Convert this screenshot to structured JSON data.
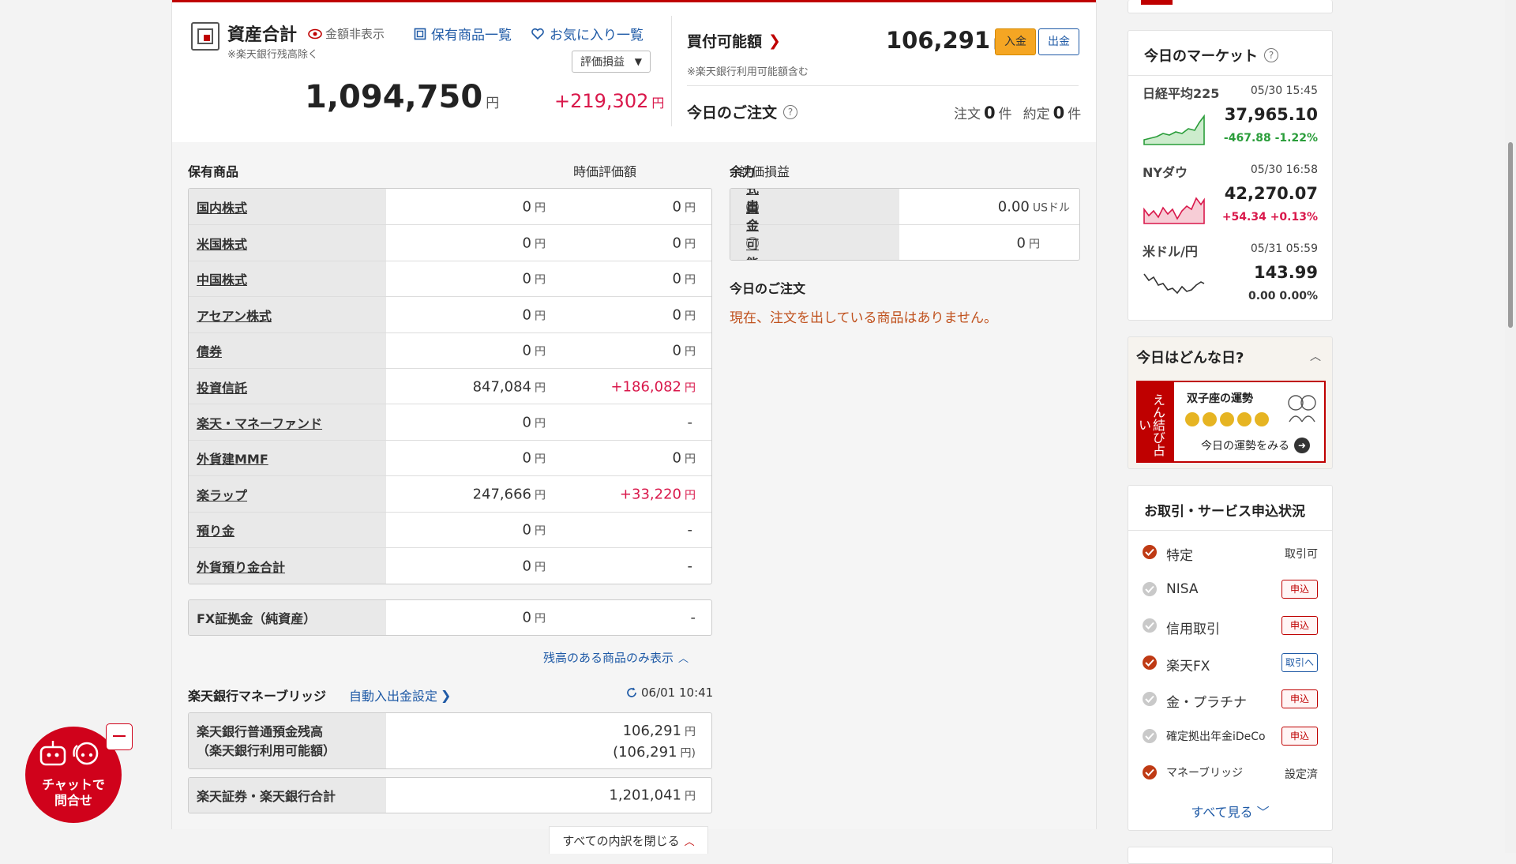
{
  "summary": {
    "title": "資産合計",
    "hide_amount": "金額非表示",
    "note": "※楽天銀行残高除く",
    "holdings_link": "保有商品一覧",
    "favorites_link": "お気に入り一覧",
    "select_label": "評価損益",
    "total_value": "1,094,750",
    "total_gain": "+219,302",
    "yen": "円"
  },
  "buying": {
    "label": "買付可能額",
    "value": "106,291",
    "yen": "円",
    "deposit_button": "入金",
    "withdraw_button": "出金",
    "note": "※楽天銀行利用可能額含む"
  },
  "today_orders": {
    "label": "今日のご注文",
    "orders_label": "注文",
    "orders_count": "0",
    "fills_label": "約定",
    "fills_count": "0",
    "unit": "件"
  },
  "holdings": {
    "header": "保有商品",
    "col_value": "時価評価額",
    "col_gain": "評価損益",
    "rows": [
      {
        "name": "国内株式",
        "value": "0",
        "gain": "0",
        "gain_yen": "円"
      },
      {
        "name": "米国株式",
        "value": "0",
        "gain": "0",
        "gain_yen": "円"
      },
      {
        "name": "中国株式",
        "value": "0",
        "gain": "0",
        "gain_yen": "円"
      },
      {
        "name": "アセアン株式",
        "value": "0",
        "gain": "0",
        "gain_yen": "円"
      },
      {
        "name": "債券",
        "value": "0",
        "gain": "0",
        "gain_yen": "円"
      },
      {
        "name": "投資信託",
        "value": "847,084",
        "gain": "+186,082",
        "gain_yen": "円"
      },
      {
        "name": "楽天・マネーファンド",
        "value": "0",
        "gain": "-",
        "gain_yen": ""
      },
      {
        "name": "外貨建MMF",
        "value": "0",
        "gain": "0",
        "gain_yen": "円"
      },
      {
        "name": "楽ラップ",
        "value": "247,666",
        "gain": "+33,220",
        "gain_yen": "円"
      },
      {
        "name": "預り金",
        "value": "0",
        "gain": "-",
        "gain_yen": ""
      },
      {
        "name": "外貨預り金合計",
        "value": "0",
        "gain": "-",
        "gain_yen": ""
      }
    ],
    "fx": {
      "name": "FX証拠金（純資産）",
      "value": "0",
      "gain": "-"
    },
    "show_toggle": "残高のある商品のみ表示",
    "yen": "円"
  },
  "yoryoku": {
    "header": "余力",
    "us_label": "米国株式買付可能額",
    "us_value": "0.00",
    "us_unit": "USドル",
    "withdraw_label": "出金可能額",
    "withdraw_value": "0",
    "yen": "円",
    "orders_title": "今日のご注文",
    "orders_empty": "現在、注文を出している商品はありません。"
  },
  "bridge": {
    "title": "楽天銀行マネーブリッジ",
    "auto_link": "自動入出金設定",
    "timestamp": "06/01 10:41",
    "balance_label_1": "楽天銀行普通預金残高",
    "balance_label_2": "（楽天銀行利用可能額）",
    "balance_value": "106,291",
    "balance_avail": "(106,291",
    "balance_avail_end": "円)",
    "total_label": "楽天証券・楽天銀行合計",
    "total_value": "1,201,041",
    "yen": "円",
    "close_all": "すべての内訳を閉じる"
  },
  "market": {
    "title": "今日のマーケット",
    "items": [
      {
        "name": "日経平均225",
        "time": "05/30 15:45",
        "value": "37,965.10",
        "change": "-467.88 -1.22%",
        "color": "#2a9d3a"
      },
      {
        "name": "NYダウ",
        "time": "05/30 16:58",
        "value": "42,270.07",
        "change": "+54.34 +0.13%",
        "color": "#d9184b"
      },
      {
        "name": "米ドル/円",
        "time": "05/31 05:59",
        "value": "143.99",
        "change": "0.00 0.00%",
        "color": "#333333"
      }
    ]
  },
  "fortune": {
    "title": "今日はどんな日?",
    "side_text": "えん結び占い",
    "sign_title": "双子座の運勢",
    "cta": "今日の運勢をみる"
  },
  "services": {
    "title": "お取引・サービス申込状況",
    "items": [
      {
        "name": "特定",
        "status": "取引可",
        "state": "on",
        "kind": "text"
      },
      {
        "name": "NISA",
        "status": "申込",
        "state": "off",
        "kind": "red"
      },
      {
        "name": "信用取引",
        "status": "申込",
        "state": "off",
        "kind": "red"
      },
      {
        "name": "楽天FX",
        "status": "取引へ",
        "state": "on",
        "kind": "blue"
      },
      {
        "name": "金・プラチナ",
        "status": "申込",
        "state": "off",
        "kind": "red"
      },
      {
        "name": "確定拠出年金iDeCo",
        "status": "申込",
        "state": "off",
        "kind": "red"
      },
      {
        "name": "マネーブリッジ",
        "status": "設定済",
        "state": "on",
        "kind": "text"
      }
    ],
    "see_all": "すべて見る"
  },
  "chat": {
    "label_1": "チャットで",
    "label_2": "問合せ"
  },
  "colors": {
    "brand_red": "#bf0000",
    "gain_red": "#d9184b",
    "link_blue": "#1f5aa6",
    "notice_orange": "#c0511d"
  }
}
